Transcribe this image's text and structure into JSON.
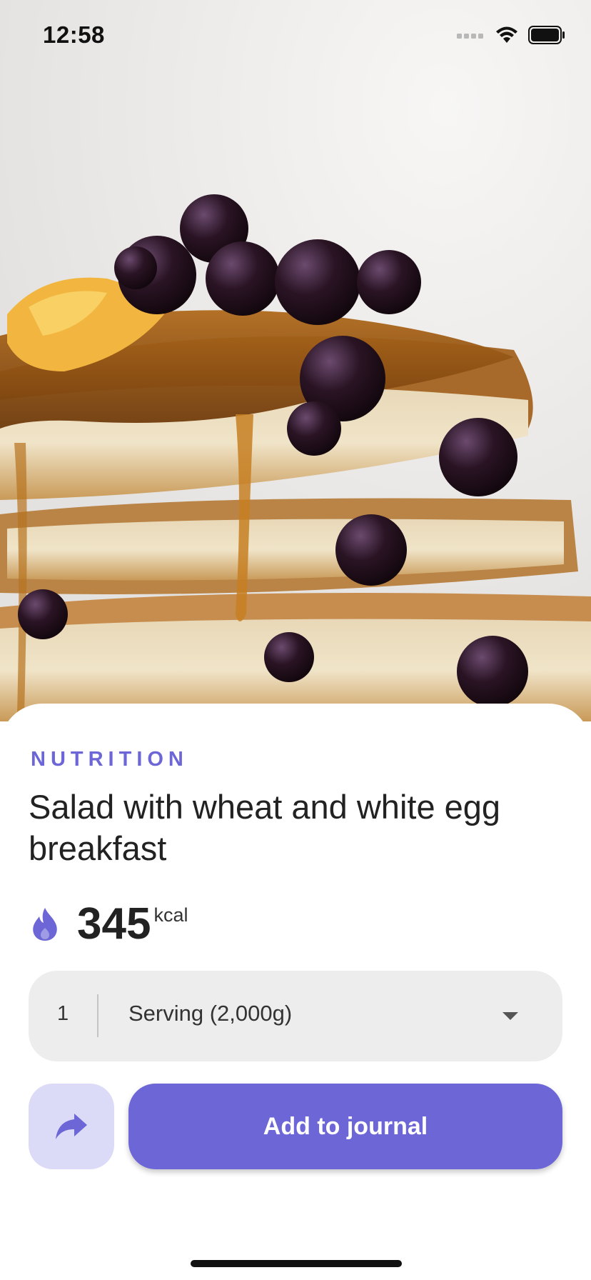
{
  "status_bar": {
    "time": "12:58",
    "icons": [
      "cellular-signal-icon",
      "wifi-icon",
      "battery-icon"
    ]
  },
  "hero": {
    "image": "food-photo"
  },
  "sheet": {
    "eyebrow": "NUTRITION",
    "title": "Salad with wheat and white egg breakfast",
    "calories": {
      "icon": "flame-icon",
      "value": "345",
      "unit": "kcal"
    },
    "serving": {
      "quantity": "1",
      "unit": "Serving (2,000g)",
      "icon": "chevron-down-icon"
    },
    "actions": {
      "share_icon": "share-icon",
      "add_label": "Add to journal"
    }
  },
  "colors": {
    "accent": "#6c66d6",
    "accent_light": "#dcdbf7",
    "field_bg": "#ededed",
    "text": "#222222"
  }
}
